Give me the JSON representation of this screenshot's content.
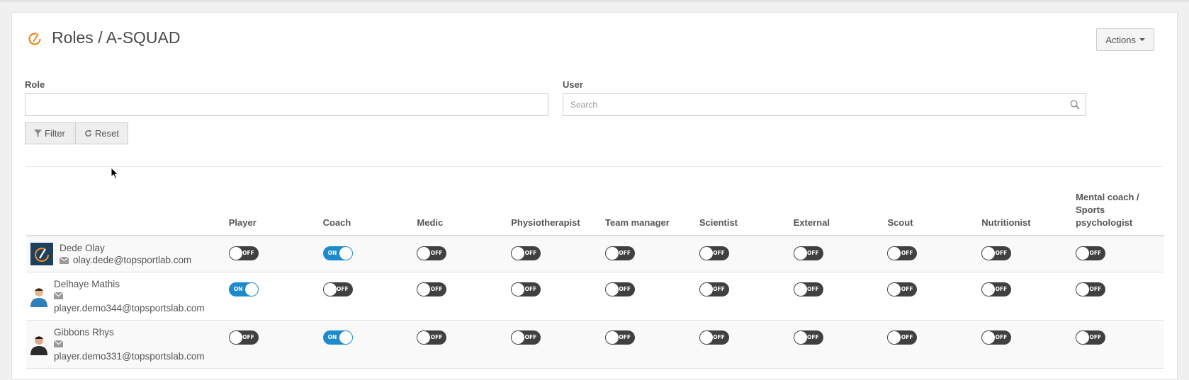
{
  "header": {
    "title": "Roles / A-SQUAD",
    "actions_label": "Actions"
  },
  "filters": {
    "role_label": "Role",
    "role_value": "",
    "user_label": "User",
    "user_placeholder": "Search",
    "filter_label": "Filter",
    "reset_label": "Reset"
  },
  "table": {
    "columns": [
      "Player",
      "Coach",
      "Medic",
      "Physiotherapist",
      "Team manager",
      "Scientist",
      "External",
      "Scout",
      "Nutritionist",
      "Mental coach / Sports psychologist"
    ],
    "rows": [
      {
        "name": "Dede Olay",
        "email": "olay.dede@topsportlab.com",
        "avatar": "club-logo",
        "roles": [
          false,
          true,
          false,
          false,
          false,
          false,
          false,
          false,
          false,
          false
        ]
      },
      {
        "name": "Delhaye Mathis",
        "email": "player.demo344@topsportslab.com",
        "avatar": "person-blue",
        "roles": [
          true,
          false,
          false,
          false,
          false,
          false,
          false,
          false,
          false,
          false
        ]
      },
      {
        "name": "Gibbons Rhys",
        "email": "player.demo331@topsportslab.com",
        "avatar": "person-dark",
        "roles": [
          false,
          true,
          false,
          false,
          false,
          false,
          false,
          false,
          false,
          false
        ]
      }
    ]
  },
  "toggle_text": {
    "on": "ON",
    "off": "OFF"
  },
  "colors": {
    "on": "#1d8acb",
    "off": "#404040",
    "brand": "#e8891d"
  }
}
